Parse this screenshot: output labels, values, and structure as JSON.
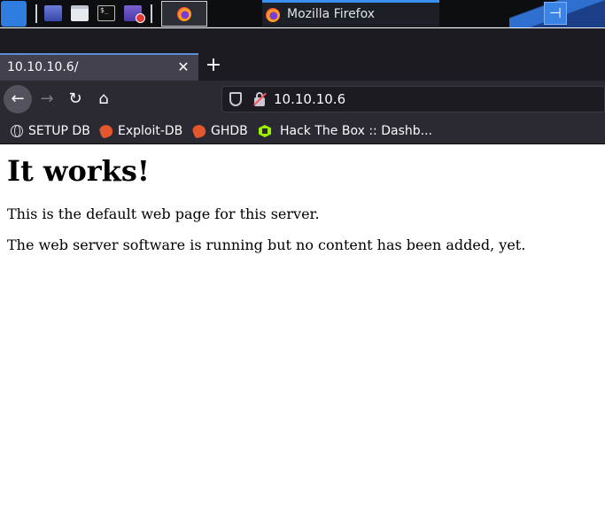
{
  "taskbar": {
    "launchers": [
      "kali-menu-icon",
      "show-desktop-icon",
      "file-manager-icon",
      "terminal-icon",
      "screen-recorder-icon"
    ],
    "active_task_icon": "firefox-icon",
    "window_title": "Mozilla Firefox",
    "tray_button_glyph": "⊣"
  },
  "browser": {
    "tab": {
      "title": "10.10.10.6/",
      "close_glyph": "✕"
    },
    "new_tab_glyph": "+",
    "nav": {
      "back_glyph": "←",
      "forward_glyph": "→",
      "reload_glyph": "↻",
      "home_glyph": "⌂"
    },
    "url": "10.10.10.6",
    "bookmarks": [
      {
        "label": "SETUP DB",
        "icon": "globe-icon"
      },
      {
        "label": "Exploit-DB",
        "icon": "exploit-db-icon"
      },
      {
        "label": "GHDB",
        "icon": "ghdb-icon"
      },
      {
        "label": "Hack The Box :: Dashb...",
        "icon": "hack-the-box-icon"
      }
    ]
  },
  "page": {
    "heading": "It works!",
    "paragraphs": [
      "This is the default web page for this server.",
      "The web server software is running but no content has been added, yet."
    ]
  },
  "colors": {
    "taskbar_bg": "#0c0e12",
    "browser_toolbar": "#2b2a33",
    "tab_active": "#42414d",
    "accent": "#3a8ff0"
  }
}
